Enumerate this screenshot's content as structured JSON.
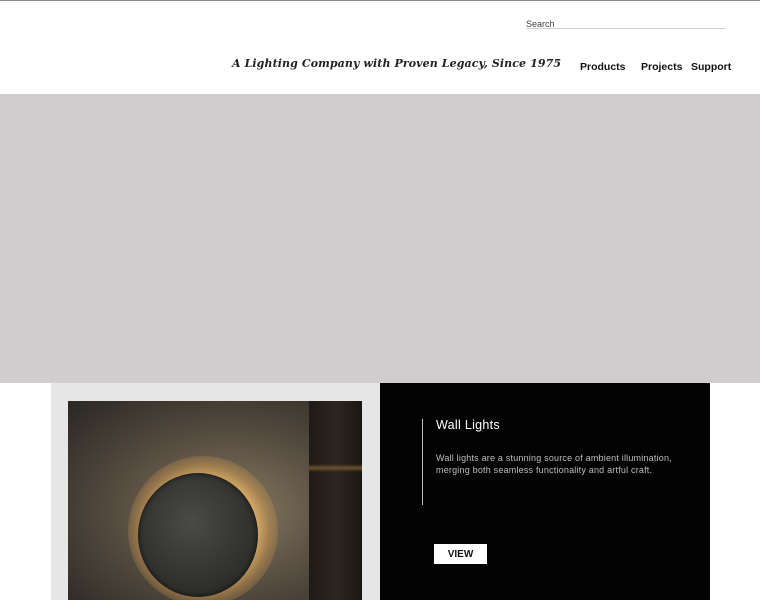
{
  "header": {
    "search_placeholder": "Search",
    "tagline": "A Lighting Company with Proven Legacy, Since 1975",
    "nav": [
      {
        "label": "Products"
      },
      {
        "label": "Projects"
      },
      {
        "label": "Support"
      }
    ]
  },
  "feature": {
    "title": "Wall Lights",
    "description": "Wall lights are a stunning source of ambient illumination, merging both seamless functionality and artful craft.",
    "button_label": "VIEW"
  },
  "colors": {
    "hero_background": "#cfcdce",
    "card_left_background": "#e6e6e6",
    "card_right_background": "#030303"
  }
}
